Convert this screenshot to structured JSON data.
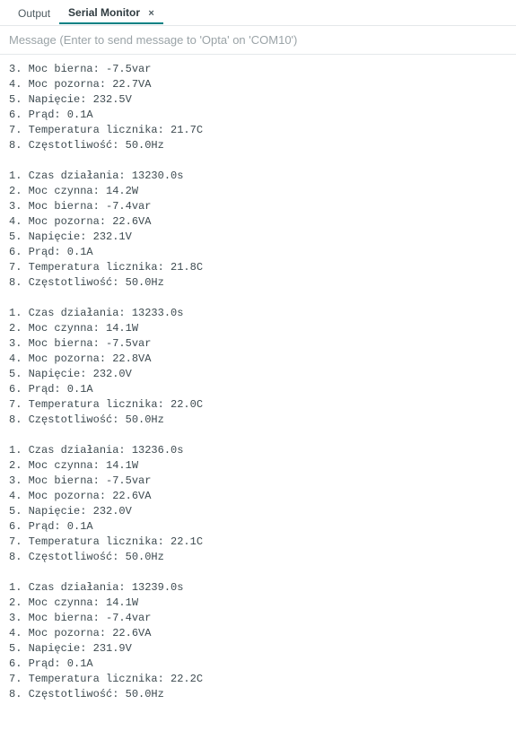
{
  "tabs": {
    "output_label": "Output",
    "serial_label": "Serial Monitor",
    "close_glyph": "×"
  },
  "input": {
    "placeholder": "Message (Enter to send message to 'Opta' on 'COM10')",
    "value": ""
  },
  "log": {
    "first_block": [
      "3. Moc bierna: -7.5var",
      "4. Moc pozorna: 22.7VA",
      "5. Napięcie: 232.5V",
      "6. Prąd: 0.1A",
      "7. Temperatura licznika: 21.7C",
      "8. Częstotliwość: 50.0Hz"
    ],
    "blocks": [
      [
        "1. Czas działania: 13230.0s",
        "2. Moc czynna: 14.2W",
        "3. Moc bierna: -7.4var",
        "4. Moc pozorna: 22.6VA",
        "5. Napięcie: 232.1V",
        "6. Prąd: 0.1A",
        "7. Temperatura licznika: 21.8C",
        "8. Częstotliwość: 50.0Hz"
      ],
      [
        "1. Czas działania: 13233.0s",
        "2. Moc czynna: 14.1W",
        "3. Moc bierna: -7.5var",
        "4. Moc pozorna: 22.8VA",
        "5. Napięcie: 232.0V",
        "6. Prąd: 0.1A",
        "7. Temperatura licznika: 22.0C",
        "8. Częstotliwość: 50.0Hz"
      ],
      [
        "1. Czas działania: 13236.0s",
        "2. Moc czynna: 14.1W",
        "3. Moc bierna: -7.5var",
        "4. Moc pozorna: 22.6VA",
        "5. Napięcie: 232.0V",
        "6. Prąd: 0.1A",
        "7. Temperatura licznika: 22.1C",
        "8. Częstotliwość: 50.0Hz"
      ],
      [
        "1. Czas działania: 13239.0s",
        "2. Moc czynna: 14.1W",
        "3. Moc bierna: -7.4var",
        "4. Moc pozorna: 22.6VA",
        "5. Napięcie: 231.9V",
        "6. Prąd: 0.1A",
        "7. Temperatura licznika: 22.2C",
        "8. Częstotliwość: 50.0Hz"
      ]
    ]
  }
}
